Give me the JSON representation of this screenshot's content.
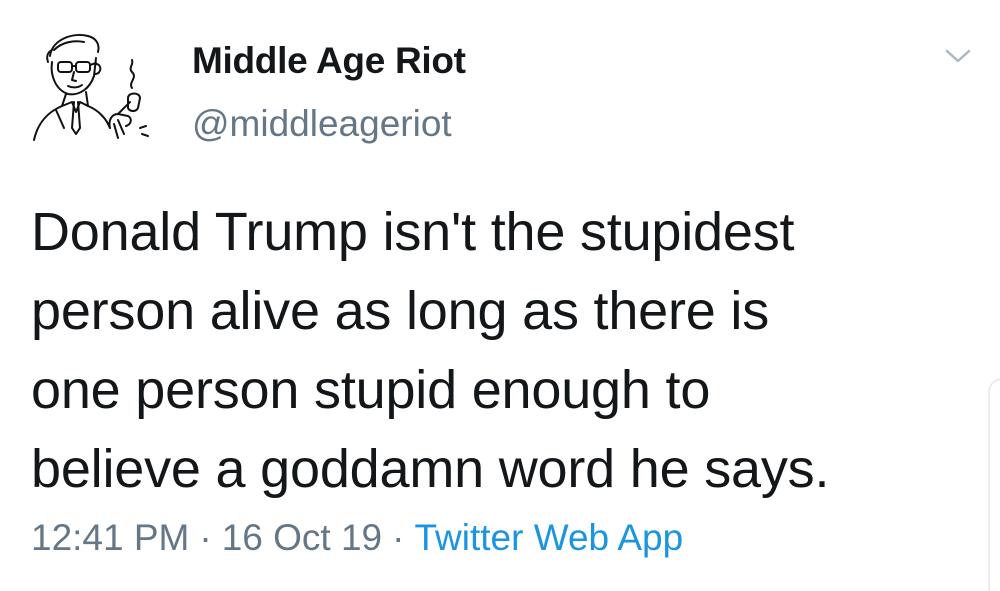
{
  "author": {
    "display_name": "Middle Age Riot",
    "handle": "@middleageriot",
    "avatar_icon": "man-smoking-pipe-sketch-icon"
  },
  "tweet": {
    "lines": [
      "Donald Trump isn't the stupidest",
      "person alive as long as there is",
      "one person stupid enough to",
      "believe a goddamn word he says."
    ]
  },
  "meta": {
    "time": "12:41 PM",
    "date": "16 Oct 19",
    "separator": "·",
    "source": "Twitter Web App"
  },
  "colors": {
    "text": "#14171a",
    "secondary": "#657786",
    "link": "#1b95e0"
  },
  "icons": {
    "menu": "chevron-down-icon"
  }
}
